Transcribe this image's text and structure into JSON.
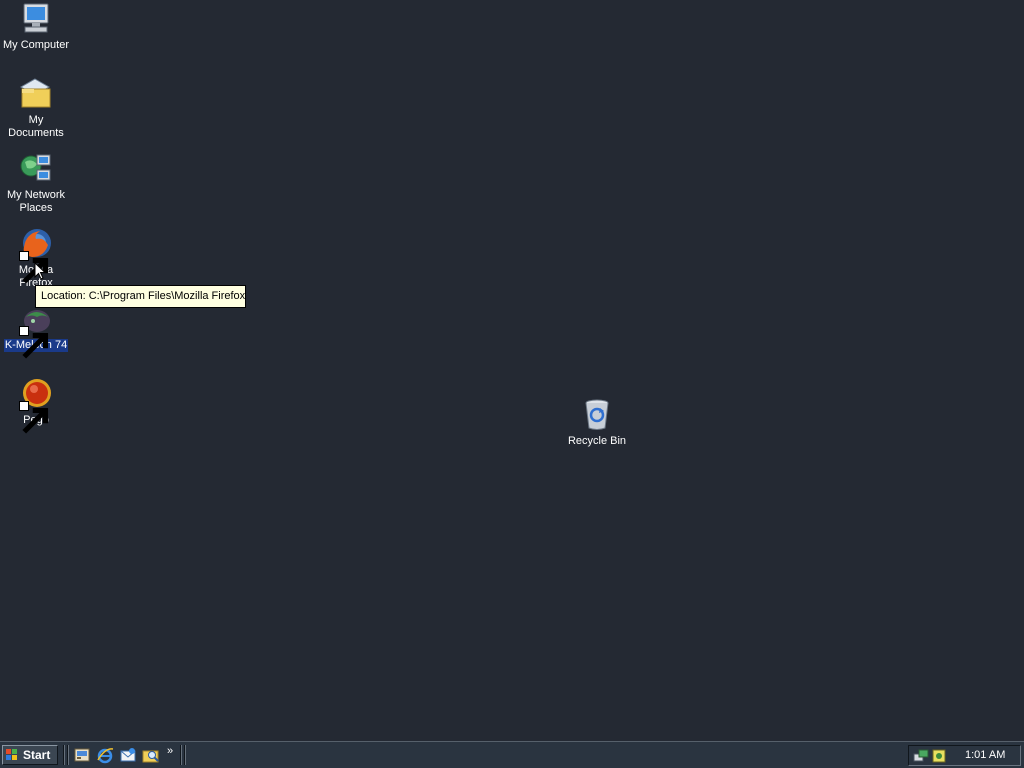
{
  "desktop": {
    "icons": [
      {
        "label": "My Computer",
        "icon": "my-computer-icon"
      },
      {
        "label": "My Documents",
        "icon": "my-documents-icon"
      },
      {
        "label": "My Network\nPlaces",
        "icon": "network-places-icon"
      },
      {
        "label": "Mozilla Firefox",
        "icon": "firefox-icon"
      },
      {
        "label": "K-Meleon 74",
        "icon": "k-meleon-icon"
      },
      {
        "label": "Pego",
        "icon": "pego-icon"
      },
      {
        "label": "Recycle Bin",
        "icon": "recycle-bin-icon"
      }
    ],
    "selected_icon": "K-Meleon 74",
    "tooltip": "Location: C:\\Program Files\\Mozilla Firefox",
    "background_color": "#242933"
  },
  "taskbar": {
    "start_label": "Start",
    "quick_launch": [
      "show-desktop-icon",
      "internet-explorer-icon",
      "outlook-express-icon",
      "windows-explorer-icon"
    ],
    "chevron": "»",
    "clock": "1:01 AM",
    "tray_icons": [
      "network-icon",
      "volume-icon"
    ]
  }
}
